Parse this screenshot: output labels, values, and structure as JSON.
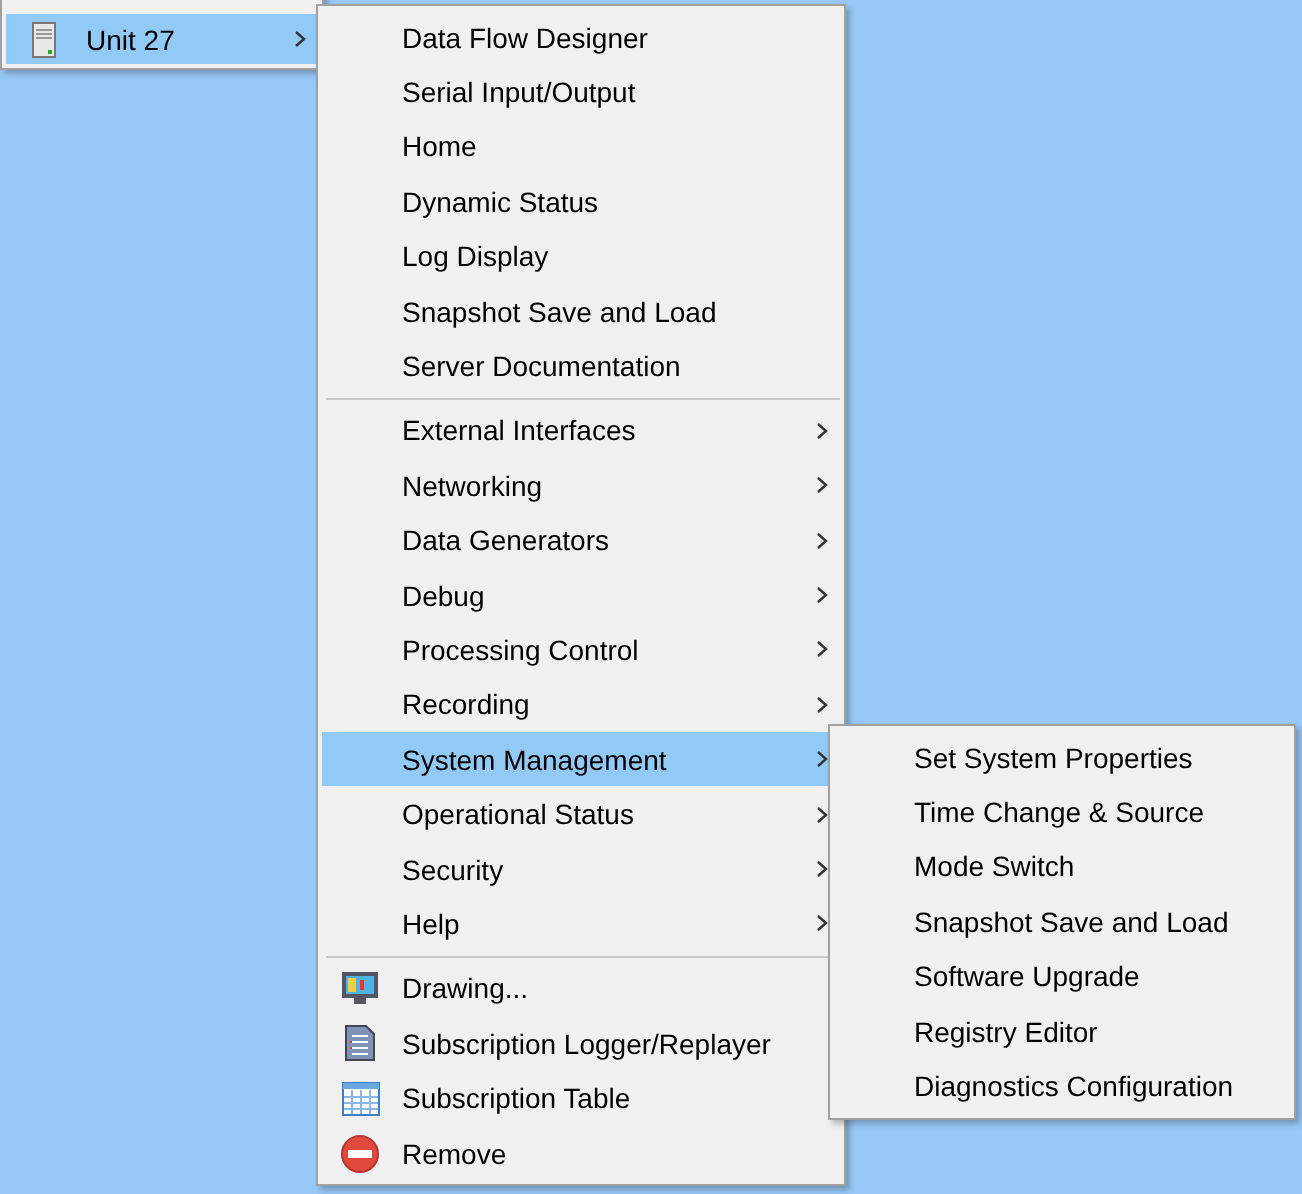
{
  "parent_menu": {
    "items": [
      {
        "label": "Unit 27",
        "kind": "server",
        "has_submenu": true,
        "selected": true
      }
    ]
  },
  "context_menu": {
    "groups": [
      {
        "items": [
          {
            "label": "Data Flow Designer",
            "has_submenu": false,
            "selected": false
          },
          {
            "label": "Serial Input/Output",
            "has_submenu": false,
            "selected": false
          },
          {
            "label": "Home",
            "has_submenu": false,
            "selected": false
          },
          {
            "label": "Dynamic Status",
            "has_submenu": false,
            "selected": false
          },
          {
            "label": "Log Display",
            "has_submenu": false,
            "selected": false
          },
          {
            "label": "Snapshot Save and Load",
            "has_submenu": false,
            "selected": false
          },
          {
            "label": "Server Documentation",
            "has_submenu": false,
            "selected": false
          }
        ]
      },
      {
        "items": [
          {
            "label": "External Interfaces",
            "has_submenu": true,
            "selected": false
          },
          {
            "label": "Networking",
            "has_submenu": true,
            "selected": false
          },
          {
            "label": "Data Generators",
            "has_submenu": true,
            "selected": false
          },
          {
            "label": "Debug",
            "has_submenu": true,
            "selected": false
          },
          {
            "label": "Processing Control",
            "has_submenu": true,
            "selected": false
          },
          {
            "label": "Recording",
            "has_submenu": true,
            "selected": false
          },
          {
            "label": "System Management",
            "has_submenu": true,
            "selected": true
          },
          {
            "label": "Operational Status",
            "has_submenu": true,
            "selected": false
          },
          {
            "label": "Security",
            "has_submenu": true,
            "selected": false
          },
          {
            "label": "Help",
            "has_submenu": true,
            "selected": false
          }
        ]
      },
      {
        "items": [
          {
            "label": "Drawing...",
            "kind": "monitor",
            "has_submenu": false,
            "selected": false
          },
          {
            "label": "Subscription Logger/Replayer",
            "kind": "document",
            "has_submenu": false,
            "selected": false
          },
          {
            "label": "Subscription Table",
            "kind": "table",
            "has_submenu": false,
            "selected": false
          },
          {
            "label": "Remove",
            "kind": "remove",
            "has_submenu": false,
            "selected": false
          }
        ]
      }
    ]
  },
  "submenu": {
    "items": [
      {
        "label": "Set System Properties",
        "selected": false
      },
      {
        "label": "Time Change & Source",
        "selected": false
      },
      {
        "label": "Mode Switch",
        "selected": false
      },
      {
        "label": "Snapshot Save and Load",
        "selected": false
      },
      {
        "label": "Software Upgrade",
        "selected": false
      },
      {
        "label": "Registry Editor",
        "selected": false
      },
      {
        "label": "Diagnostics Configuration",
        "selected": false
      }
    ]
  }
}
